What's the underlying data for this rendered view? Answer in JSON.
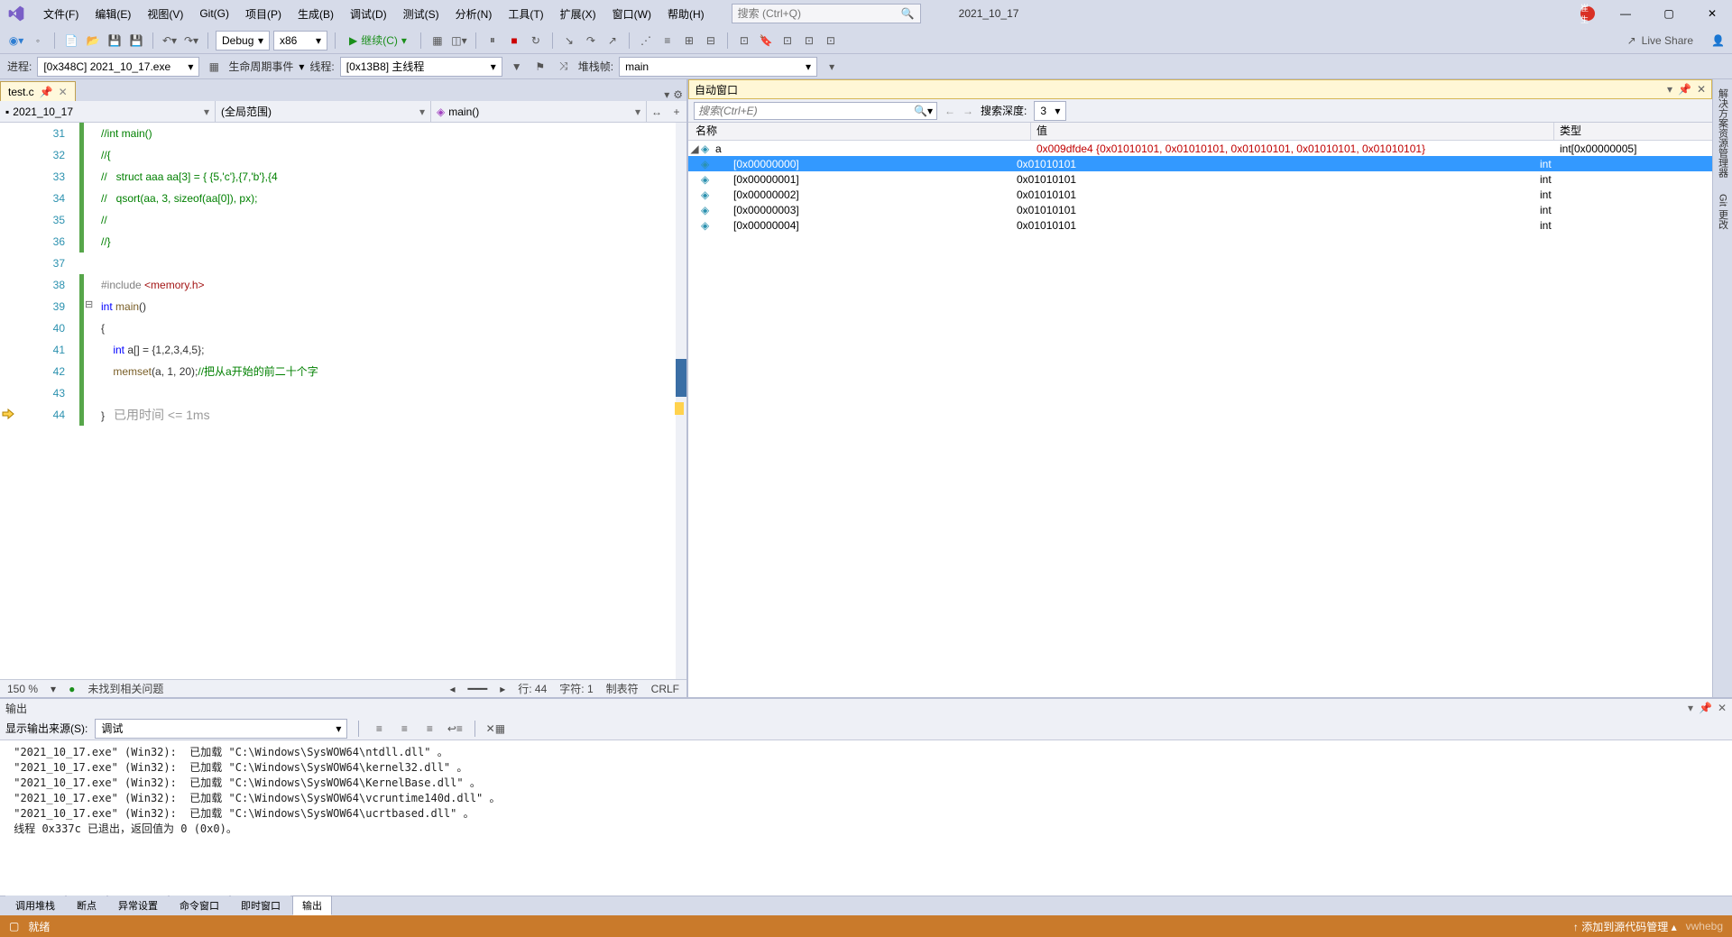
{
  "menu": {
    "file": "文件(F)",
    "edit": "编辑(E)",
    "view": "视图(V)",
    "git": "Git(G)",
    "project": "项目(P)",
    "build": "生成(B)",
    "debug": "调试(D)",
    "test": "测试(S)",
    "analyze": "分析(N)",
    "tools": "工具(T)",
    "extend": "扩展(X)",
    "window": "窗口(W)",
    "help": "帮助(H)"
  },
  "search": {
    "placeholder": "搜索 (Ctrl+Q)"
  },
  "solution_name": "2021_10_17",
  "badge": "崔生",
  "toolbar": {
    "config": "Debug",
    "platform": "x86",
    "continue": "继续(C)",
    "live_share": "Live Share"
  },
  "procbar": {
    "proc_lbl": "进程:",
    "proc_val": "[0x348C] 2021_10_17.exe",
    "life": "生命周期事件",
    "thread_lbl": "线程:",
    "thread_val": "[0x13B8] 主线程",
    "stack_lbl": "堆栈帧:",
    "stack_val": "main"
  },
  "tabs": {
    "file": "test.c"
  },
  "nav": {
    "scope1": "2021_10_17",
    "scope2": "(全局范围)",
    "scope3": "main()"
  },
  "code": {
    "lines": [
      {
        "n": 31,
        "html": "<span class='c-comment'>//int main()</span>"
      },
      {
        "n": 32,
        "html": "<span class='c-comment'>//{</span>"
      },
      {
        "n": 33,
        "html": "<span class='c-comment'>//   struct aaa aa[3] = { {5,'c'},{7,'b'},{4</span>"
      },
      {
        "n": 34,
        "html": "<span class='c-comment'>//   qsort(aa, 3, sizeof(aa[0]), px);</span>"
      },
      {
        "n": 35,
        "html": "<span class='c-comment'>//</span>"
      },
      {
        "n": 36,
        "html": "<span class='c-comment'>//}</span>"
      },
      {
        "n": 37,
        "html": ""
      },
      {
        "n": 38,
        "html": "<span class='c-inc'>#include </span><span class='c-hdr'>&lt;memory.h&gt;</span>"
      },
      {
        "n": 39,
        "html": "<span class='c-kw'>int</span> <span class='c-func'>main</span>()"
      },
      {
        "n": 40,
        "html": "{"
      },
      {
        "n": 41,
        "html": "    <span class='c-kw'>int</span> a[] = {1,2,3,4,5};"
      },
      {
        "n": 42,
        "html": "    <span class='c-func'>memset</span>(a, 1, 20);<span class='c-comment'>//把从a开始的前二十个字</span>"
      },
      {
        "n": 43,
        "html": ""
      },
      {
        "n": 44,
        "html": "}   <span class='codelens'>已用时间 &lt;= 1ms</span>"
      }
    ]
  },
  "editor_status": {
    "zoom": "150 %",
    "issues": "未找到相关问题",
    "line": "行: 44",
    "col": "字符: 1",
    "tab": "制表符",
    "eol": "CRLF"
  },
  "auto": {
    "title": "自动窗口",
    "search_placeholder": "搜索(Ctrl+E)",
    "depth_lbl": "搜索深度:",
    "depth_val": "3",
    "hdr_name": "名称",
    "hdr_val": "值",
    "hdr_type": "类型",
    "rows": [
      {
        "exp": "◢",
        "indent": 0,
        "name": "a",
        "val": "0x009dfde4 {0x01010101, 0x01010101, 0x01010101, 0x01010101, 0x01010101}",
        "type": "int[0x00000005]",
        "red": true
      },
      {
        "indent": 1,
        "name": "[0x00000000]",
        "val": "0x01010101",
        "type": "int",
        "sel": true
      },
      {
        "indent": 1,
        "name": "[0x00000001]",
        "val": "0x01010101",
        "type": "int"
      },
      {
        "indent": 1,
        "name": "[0x00000002]",
        "val": "0x01010101",
        "type": "int"
      },
      {
        "indent": 1,
        "name": "[0x00000003]",
        "val": "0x01010101",
        "type": "int"
      },
      {
        "indent": 1,
        "name": "[0x00000004]",
        "val": "0x01010101",
        "type": "int"
      }
    ]
  },
  "vtabs": {
    "sol": "解决方案资源管理器",
    "git": "Git 更改"
  },
  "output": {
    "title": "输出",
    "src_lbl": "显示输出来源(S):",
    "src_val": "调试",
    "body": " \"2021_10_17.exe\" (Win32):  已加载 \"C:\\Windows\\SysWOW64\\ntdll.dll\" 。\n \"2021_10_17.exe\" (Win32):  已加载 \"C:\\Windows\\SysWOW64\\kernel32.dll\" 。\n \"2021_10_17.exe\" (Win32):  已加载 \"C:\\Windows\\SysWOW64\\KernelBase.dll\" 。\n \"2021_10_17.exe\" (Win32):  已加载 \"C:\\Windows\\SysWOW64\\vcruntime140d.dll\" 。\n \"2021_10_17.exe\" (Win32):  已加载 \"C:\\Windows\\SysWOW64\\ucrtbased.dll\" 。\n 线程 0x337c 已退出，返回值为 0 (0x0)。"
  },
  "bottom_tabs": [
    "调用堆栈",
    "断点",
    "异常设置",
    "命令窗口",
    "即时窗口",
    "输出"
  ],
  "bottom_active": "输出",
  "statusbar": {
    "state": "就绪",
    "add": "↑ 添加到源代码管理 ▴",
    "watermark": "vwhebg"
  }
}
